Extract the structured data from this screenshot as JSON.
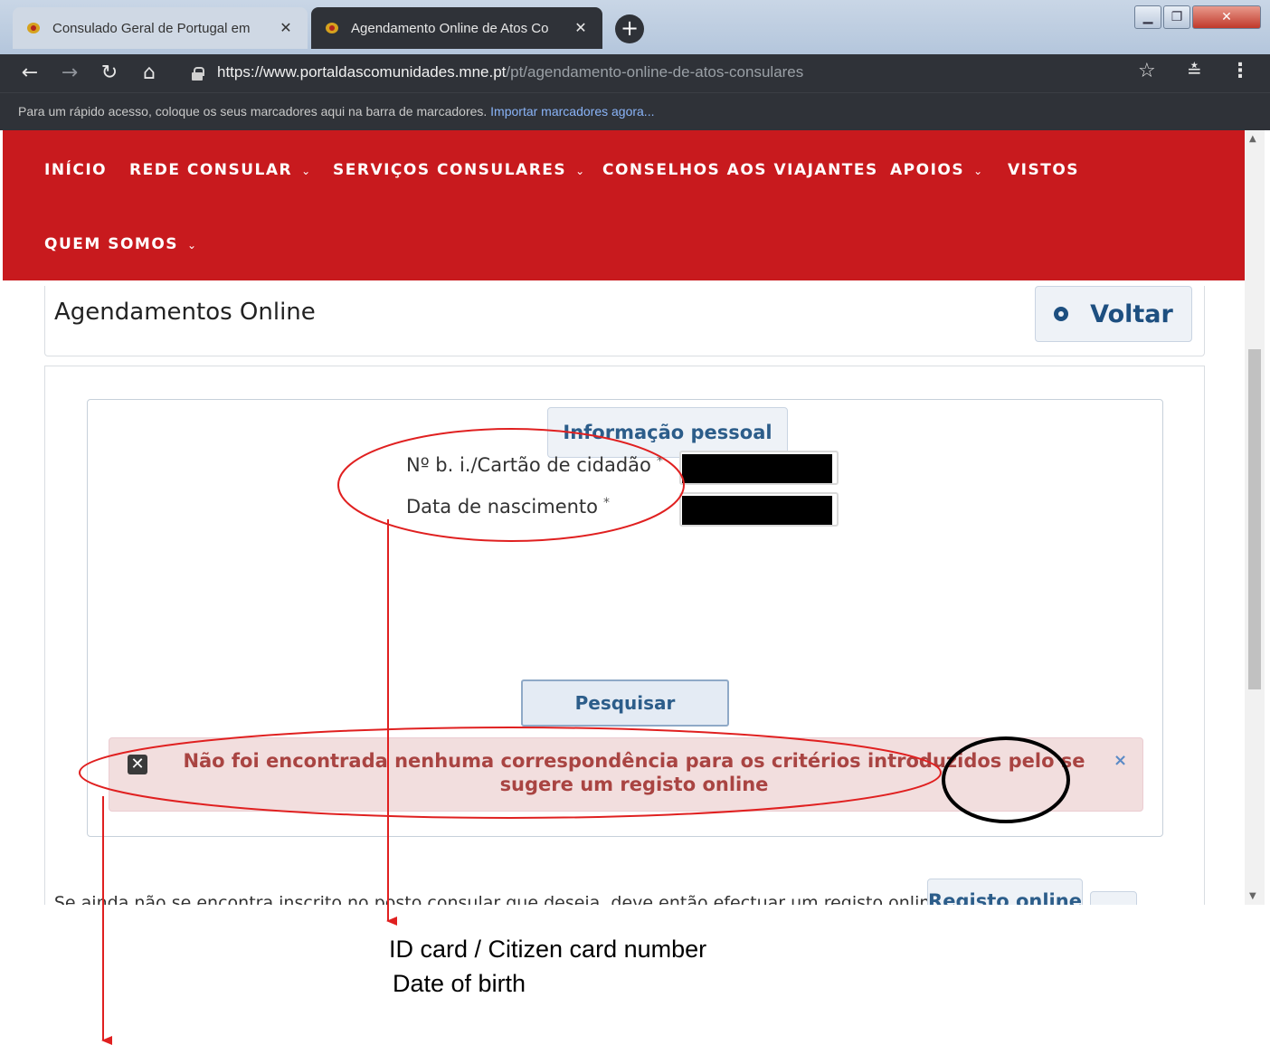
{
  "browser": {
    "tabs": [
      {
        "title": "Consulado Geral de Portugal em",
        "close": "✕"
      },
      {
        "title": "Agendamento Online de Atos Co",
        "close": "✕"
      }
    ],
    "new_tab": "+",
    "url_host": "https://www.portaldascomunidades.mne.pt",
    "url_path": "/pt/agendamento-online-de-atos-consulares",
    "bookmarks_text": "Para um rápido acesso, coloque os seus marcadores aqui na barra de marcadores.",
    "bookmarks_link": "Importar marcadores agora..."
  },
  "site_nav": {
    "items": [
      {
        "label": "INÍCIO",
        "dropdown": false
      },
      {
        "label": "REDE CONSULAR",
        "dropdown": true
      },
      {
        "label": "SERVIÇOS CONSULARES",
        "dropdown": true
      },
      {
        "label": "CONSELHOS AOS VIAJANTES",
        "dropdown": false
      },
      {
        "label": "APOIOS",
        "dropdown": true
      },
      {
        "label": "VISTOS",
        "dropdown": false
      },
      {
        "label": "QUEM SOMOS",
        "dropdown": true
      }
    ],
    "chevron": "⌄"
  },
  "page": {
    "title": "Agendamentos Online",
    "back_button": "Voltar"
  },
  "form": {
    "legend": "Informação pessoal",
    "id_label": "Nº b. i./Cartão de cidadão",
    "dob_label": "Data de nascimento",
    "required_mark": "*",
    "search_button": "Pesquisar"
  },
  "alert": {
    "message": "Não foi encontrada nenhuma correspondência para os critérios introduzidos pelo se sugere um registo online",
    "close": "×"
  },
  "registration": {
    "text": "Se ainda não se encontra inscrito no posto consular que deseja, deve então efectuar um registo online",
    "button": "Registo online"
  },
  "annotations": {
    "caption_line1": "ID card / Citizen card number",
    "caption_line2": "Date of birth"
  },
  "colors": {
    "brand_red": "#c81a1e",
    "annotation_red": "#e02020",
    "link_blue": "#2c5d8a",
    "alert_text": "#a94442",
    "alert_bg": "#f2dede"
  }
}
